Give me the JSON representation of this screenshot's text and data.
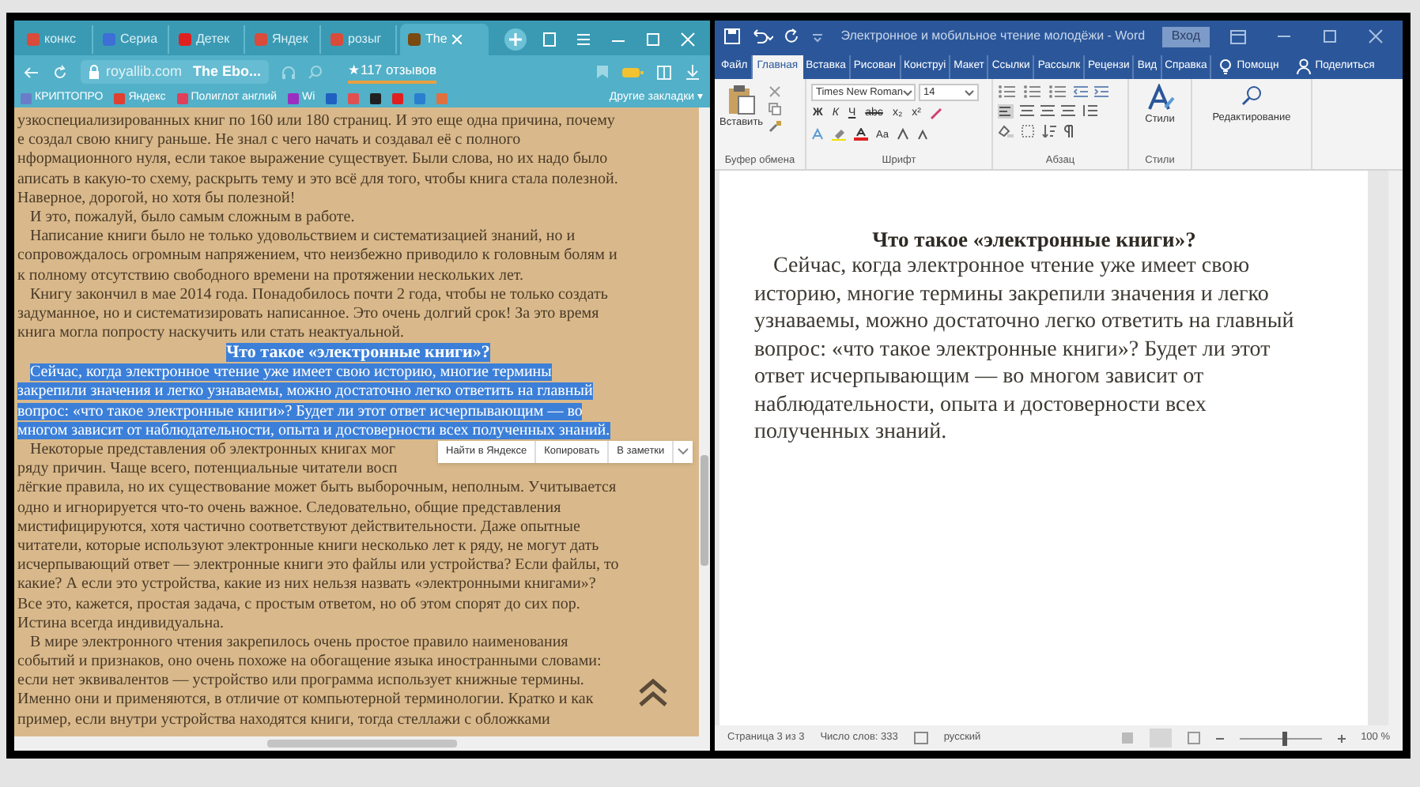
{
  "browser": {
    "tabs": [
      {
        "label": "конкс",
        "selected": false
      },
      {
        "label": "Сериа",
        "selected": false
      },
      {
        "label": "Детек",
        "selected": false
      },
      {
        "label": "Яндек",
        "selected": false
      },
      {
        "label": "розыг",
        "selected": false
      },
      {
        "label": "The",
        "selected": true
      }
    ],
    "address": {
      "domain": "royallib.com",
      "page_title": "The Ebo...",
      "reviews": "★117 отзывов"
    },
    "bookmarks": [
      "КРИПТОПРО",
      "Яндекс",
      "Полиглот англий",
      "Wi"
    ],
    "other_bookmarks": "Другие закладки ▾",
    "lines": [
      {
        "text": "узкоспециализированных книг по 160 или 180 страниц. И это еще одна причина, почему",
        "kind": "plain",
        "selected": false
      },
      {
        "text": "е создал свою книгу раньше. Не знал с чего начать и создавал её с полного",
        "kind": "plain",
        "selected": false
      },
      {
        "text": "нформационного нуля, если такое выражение существует. Были слова, но их надо было",
        "kind": "plain",
        "selected": false
      },
      {
        "text": "аписать в какую-то схему, раскрыть тему и это всё для того, чтобы книга стала полезной.",
        "kind": "plain",
        "selected": false
      },
      {
        "text": "Наверное, дорогой, но хотя бы полезной!",
        "kind": "plain",
        "selected": false
      },
      {
        "text": "И это, пожалуй, было самым сложным в работе.",
        "kind": "indent",
        "selected": false
      },
      {
        "text": "Написание книги было не только удовольствием и систематизацией знаний, но и",
        "kind": "indent",
        "selected": false
      },
      {
        "text": "сопровождалось огромным напряжением, что неизбежно приводило к головным болям и",
        "kind": "plain",
        "selected": false
      },
      {
        "text": "к полному отсутствию свободного времени на протяжении нескольких лет.",
        "kind": "plain",
        "selected": false
      },
      {
        "text": "Книгу закончил в мае 2014 года. Понадобилось почти 2 года, чтобы не только создать",
        "kind": "indent",
        "selected": false
      },
      {
        "text": "задуманное, но и систематизировать написанное. Это очень долгий срок! За это время",
        "kind": "plain",
        "selected": false
      },
      {
        "text": "книга могла попросту наскучить или стать неактуальной.",
        "kind": "plain",
        "selected": false
      },
      {
        "text": "Что такое «электронные книги»?",
        "kind": "heading",
        "selected": true
      },
      {
        "text": "Сейчас, когда электронное чтение уже имеет свою историю, многие термины",
        "kind": "indent",
        "selected": true
      },
      {
        "text": "закрепили значения и легко узнаваемы, можно достаточно легко ответить на главный",
        "kind": "plain",
        "selected": true
      },
      {
        "text": "вопрос: «что такое электронные книги»? Будет ли этот ответ исчерпывающим — во",
        "kind": "plain",
        "selected": true
      },
      {
        "text": "многом зависит от наблюдательности, опыта и достоверности всех полученных знаний.",
        "kind": "plain",
        "selected": true
      },
      {
        "text": "Некоторые представления об электронных книгах мог",
        "kind": "indent",
        "selected": false
      },
      {
        "text": "ряду причин. Чаще всего, потенциальные читатели восп",
        "kind": "plain",
        "selected": false
      },
      {
        "text": "лёгкие правила, но их существование может быть выборочным, неполным. Учитывается",
        "kind": "plain",
        "selected": false
      },
      {
        "text": "одно и игнорируется что-то очень важное. Следовательно, общие представления",
        "kind": "plain",
        "selected": false
      },
      {
        "text": "мистифицируются, хотя частично соответствуют действительности. Даже опытные",
        "kind": "plain",
        "selected": false
      },
      {
        "text": "читатели, которые используют электронные книги несколько лет к ряду, не могут дать",
        "kind": "plain",
        "selected": false
      },
      {
        "text": "исчерпывающий ответ — электронные книги это файлы или устройства? Если файлы, то",
        "kind": "plain",
        "selected": false
      },
      {
        "text": "какие? А если это устройства, какие из них нельзя назвать «электронными книгами»?",
        "kind": "plain",
        "selected": false
      },
      {
        "text": "Все это, кажется, простая задача, с простым ответом, но об этом спорят до сих пор.",
        "kind": "plain",
        "selected": false
      },
      {
        "text": "Истина всегда индивидуальна.",
        "kind": "plain",
        "selected": false
      },
      {
        "text": "В мире электронного чтения закрепилось очень простое правило наименования",
        "kind": "indent",
        "selected": false
      },
      {
        "text": "событий и признаков, оно очень похоже на обогащение языка иностранными словами:",
        "kind": "plain",
        "selected": false
      },
      {
        "text": "если нет эквивалентов — устройство или программа использует книжные термины.",
        "kind": "plain",
        "selected": false
      },
      {
        "text": "Именно они и применяются, в отличие от компьютерной терминологии. Кратко и как",
        "kind": "plain",
        "selected": false
      },
      {
        "text": "пример, если внутри устройства находятся книги, тогда стеллажи с обложками",
        "kind": "plain",
        "selected": false
      }
    ],
    "context_menu": [
      "Найти в Яндексе",
      "Копировать",
      "В заметки"
    ]
  },
  "word": {
    "title": "Электронное и мобильное чтение молодёжи - Word",
    "sign_in": "Вход",
    "tabs": [
      {
        "label": "Файл",
        "selected": false
      },
      {
        "label": "Главная",
        "selected": true
      },
      {
        "label": "Вставка",
        "selected": false
      },
      {
        "label": "Рисован",
        "selected": false
      },
      {
        "label": "Конструі",
        "selected": false
      },
      {
        "label": "Макет",
        "selected": false
      },
      {
        "label": "Ссылки",
        "selected": false
      },
      {
        "label": "Рассылк",
        "selected": false
      },
      {
        "label": "Рецензи",
        "selected": false
      },
      {
        "label": "Вид",
        "selected": false
      },
      {
        "label": "Справка",
        "selected": false
      }
    ],
    "help": "Помощн",
    "share": "Поделиться",
    "ribbon": {
      "paste": "Вставить",
      "font_name": "Times New Roman",
      "font_size": "14",
      "format_buttons": [
        "Ж",
        "К",
        "Ч",
        "abc",
        "x₂",
        "x²"
      ],
      "case_button": "Aa",
      "styles": "Стили",
      "editing": "Редактирование",
      "groups": [
        "Буфер обмена",
        "Шрифт",
        "Абзац",
        "Стили"
      ]
    },
    "document": {
      "heading": "Что такое «электронные книги»?",
      "paragraph": "Сейчас, когда электронное чтение уже имеет свою историю, многие термины закрепили значения и легко узнаваемы, можно достаточно легко ответить на главный вопрос: «что такое электронные книги»? Будет ли этот ответ исчерпывающим — во многом зависит от наблюдательности, опыта и достоверности всех полученных знаний."
    },
    "status_bar": {
      "page": "Страница 3 из 3",
      "words": "Число слов: 333",
      "language": "русский",
      "zoom": {
        "level": 0.55,
        "reading": "100 %"
      }
    }
  }
}
